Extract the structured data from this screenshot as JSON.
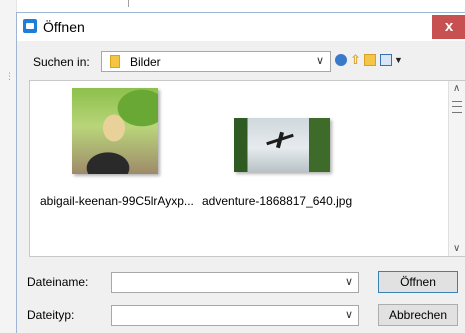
{
  "dialog": {
    "title": "Öffnen",
    "close_label": "x"
  },
  "lookin": {
    "label": "Suchen in:",
    "value": "Bilder",
    "icons": [
      "back-icon",
      "up-folder-icon",
      "new-folder-icon",
      "view-menu-icon"
    ]
  },
  "files": [
    {
      "name": "abigail-keenan-99C5lrAyxp...",
      "thumbnail": "woman-blonde-hair-photo"
    },
    {
      "name": "adventure-1868817_640.jpg",
      "thumbnail": "person-jumping-photo"
    }
  ],
  "form": {
    "filename_label": "Dateiname:",
    "filename_value": "",
    "filetype_label": "Dateityp:",
    "filetype_value": "",
    "open_label": "Öffnen",
    "cancel_label": "Abbrechen"
  },
  "colors": {
    "accent": "#1e7fd8",
    "close": "#c75050"
  }
}
